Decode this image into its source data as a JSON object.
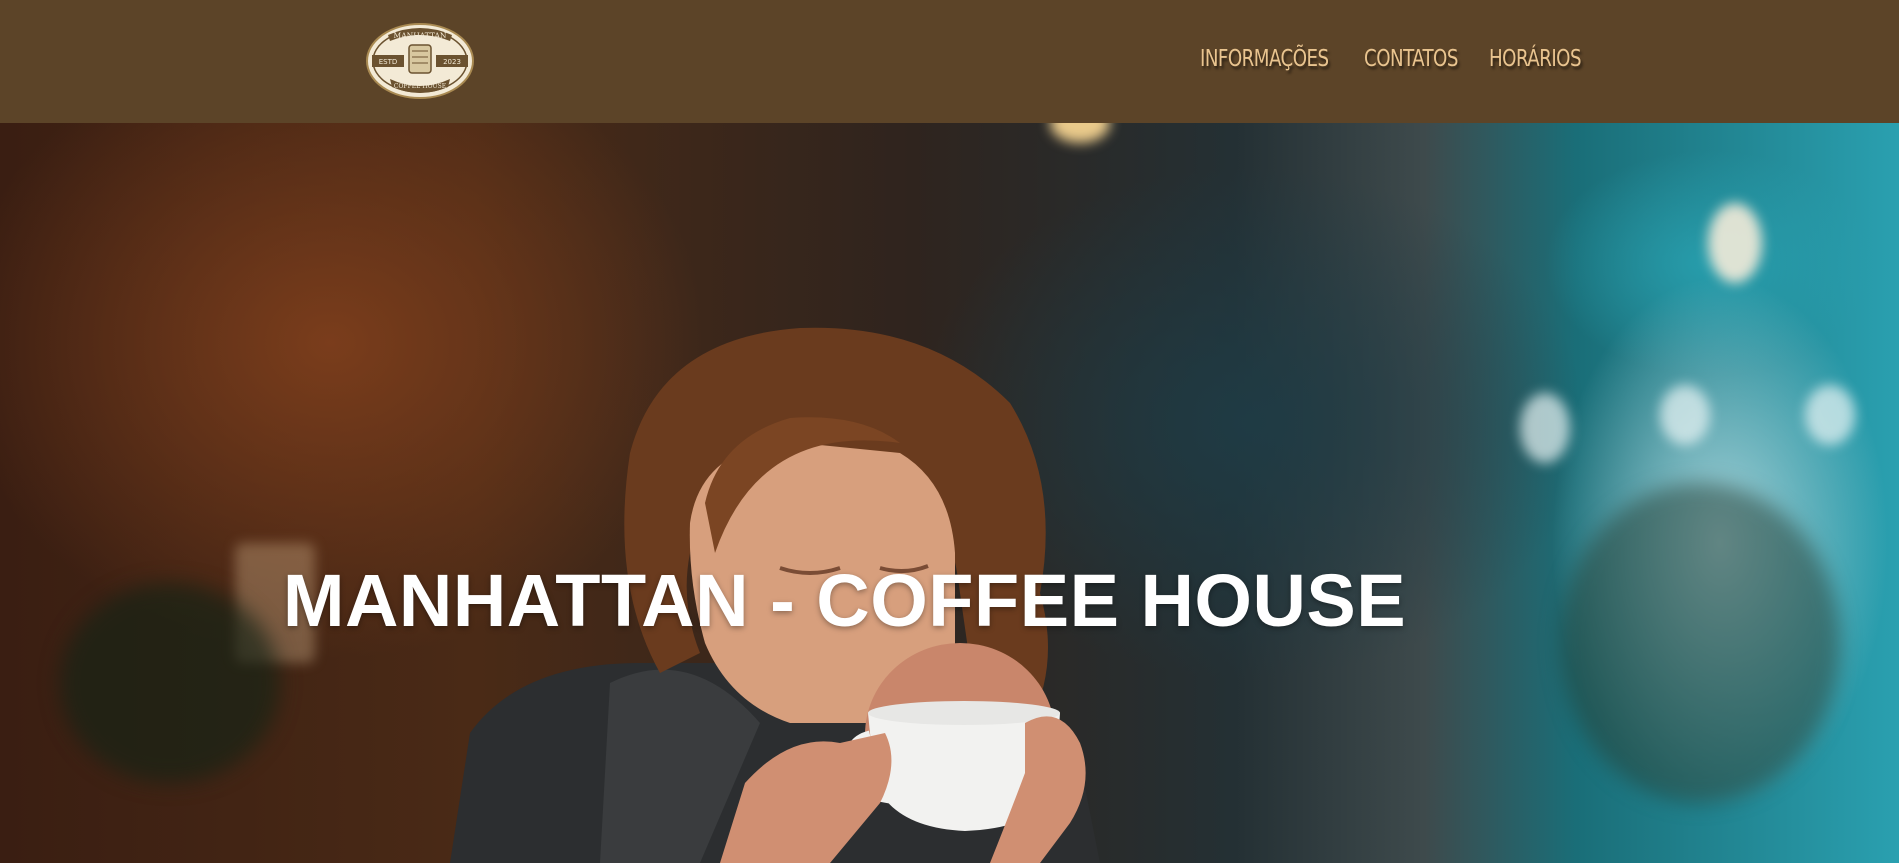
{
  "header": {
    "logo": {
      "top_text": "MANHATTAN",
      "left_text": "ESTD",
      "right_text": "2023",
      "bottom_text": "COFFEE HOUSE"
    },
    "nav": [
      {
        "label": "INFORMAÇÕES"
      },
      {
        "label": "CONTATOS"
      },
      {
        "label": "HORÁRIOS"
      }
    ],
    "colors": {
      "bar": "#5c4428",
      "nav_text": "#e9c48f"
    }
  },
  "hero": {
    "title": "MANHATTAN - COFFEE HOUSE",
    "image": "woman-drinking-coffee-photo"
  }
}
